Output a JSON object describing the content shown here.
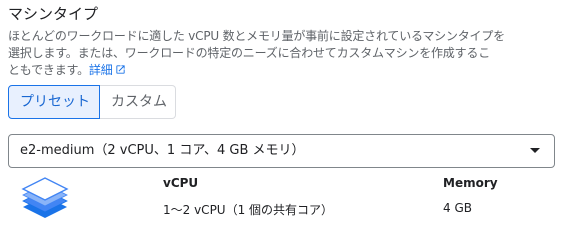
{
  "section": {
    "title": "マシンタイプ",
    "description_lines": [
      "ほとんどのワークロードに適した vCPU 数とメモリ量が事前に設定されているマシンタイプを",
      "選択します。または、ワークロードの特定のニーズに合わせてカスタムマシンを作成するこ",
      "ともできます。"
    ],
    "learn_more_label": "詳細"
  },
  "toggle": {
    "preset_label": "プリセット",
    "custom_label": "カスタム",
    "selected": "preset"
  },
  "machine_select": {
    "value": "e2-medium（2 vCPU、1 コア、4 GB メモリ）"
  },
  "specs": {
    "vcpu_header": "vCPU",
    "vcpu_value": "1～2 vCPU（1 個の共有コア）",
    "memory_header": "Memory",
    "memory_value": "4 GB"
  },
  "colors": {
    "accent": "#1a73e8",
    "active_bg": "#e8f0fe",
    "icon_blue": "#4285f4"
  },
  "icons": {
    "external_link": "open-in-new-icon",
    "dropdown": "arrow-drop-down-icon",
    "machine": "stacked-layers-icon"
  }
}
